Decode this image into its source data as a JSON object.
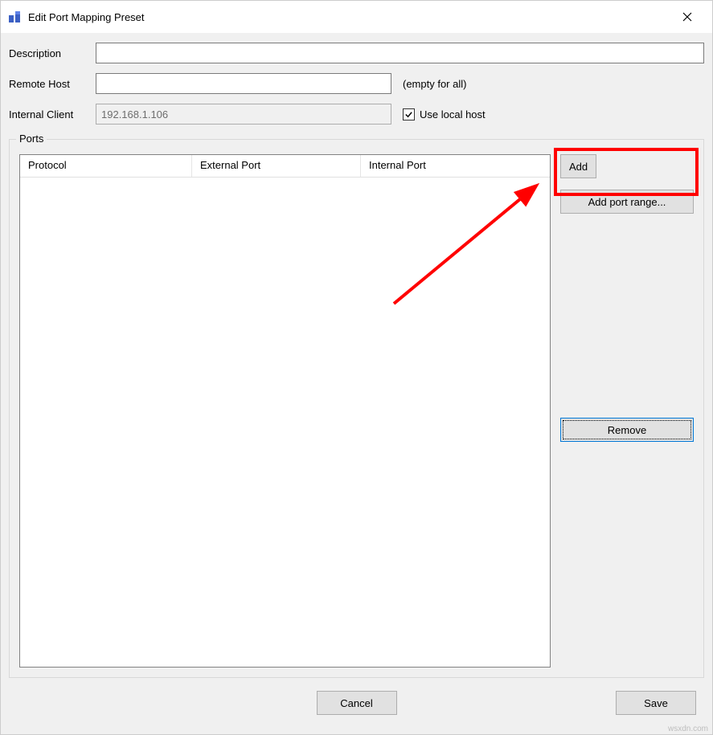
{
  "window": {
    "title": "Edit Port Mapping Preset"
  },
  "form": {
    "description_label": "Description",
    "description_value": "",
    "remote_host_label": "Remote Host",
    "remote_host_value": "",
    "remote_host_hint": "(empty for all)",
    "internal_client_label": "Internal Client",
    "internal_client_value": "192.168.1.106",
    "use_local_host_label": "Use local host",
    "use_local_host_checked": true
  },
  "ports": {
    "group_label": "Ports",
    "columns": {
      "protocol": "Protocol",
      "external": "External Port",
      "internal": "Internal Port"
    },
    "buttons": {
      "add": "Add",
      "add_range": "Add port range...",
      "remove": "Remove"
    }
  },
  "footer": {
    "cancel": "Cancel",
    "save": "Save"
  },
  "watermark": "wsxdn.com"
}
